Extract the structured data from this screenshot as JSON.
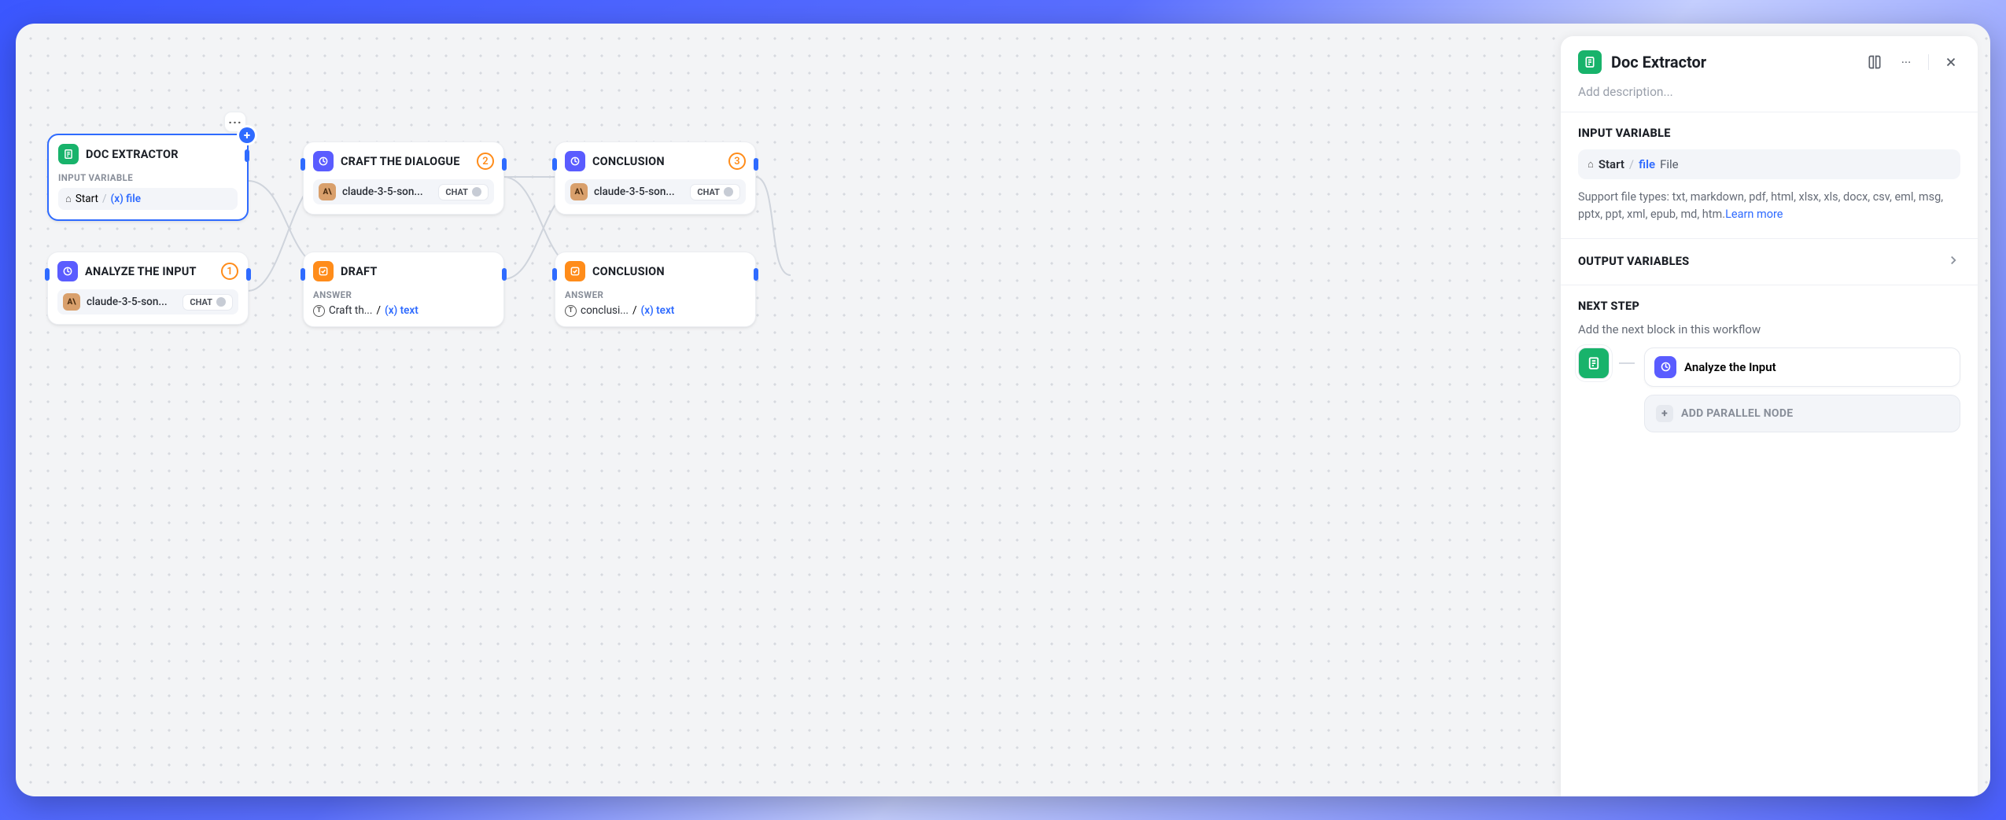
{
  "canvas": {
    "more_button": "···",
    "nodes": {
      "doc_extractor": {
        "title": "DOC EXTRACTOR",
        "section_label": "INPUT VARIABLE",
        "pill_start": "Start",
        "pill_var": "(x) file"
      },
      "analyze_input": {
        "title": "ANALYZE THE INPUT",
        "badge": "1",
        "model": "claude-3-5-son...",
        "chip": "CHAT"
      },
      "craft_dialogue": {
        "title": "CRAFT THE DIALOGUE",
        "badge": "2",
        "model": "claude-3-5-son...",
        "chip": "CHAT"
      },
      "draft": {
        "title": "DRAFT",
        "section_label": "ANSWER",
        "answer_ref": "Craft th...",
        "var": "(x) text"
      },
      "conclusion": {
        "title": "CONCLUSION",
        "badge": "3",
        "model": "claude-3-5-son...",
        "chip": "CHAT"
      },
      "conclusion_answer": {
        "title": "CONCLUSION",
        "section_label": "ANSWER",
        "answer_ref": "conclusi...",
        "var": "(x) text"
      }
    }
  },
  "panel": {
    "title": "Doc Extractor",
    "description_placeholder": "Add description...",
    "sections": {
      "input_variable": {
        "label": "INPUT VARIABLE",
        "start": "Start",
        "file_key": "file",
        "file_type": "File",
        "help_text": "Support file types: txt, markdown, pdf, html, xlsx, xls, docx, csv, eml, msg, pptx, ppt, xml, epub, md, htm.",
        "learn_more": "Learn more"
      },
      "output_variables": {
        "label": "OUTPUT VARIABLES"
      },
      "next_step": {
        "label": "NEXT STEP",
        "sub": "Add the next block in this workflow",
        "next_node": "Analyze the Input",
        "add_parallel": "ADD PARALLEL NODE"
      }
    }
  }
}
